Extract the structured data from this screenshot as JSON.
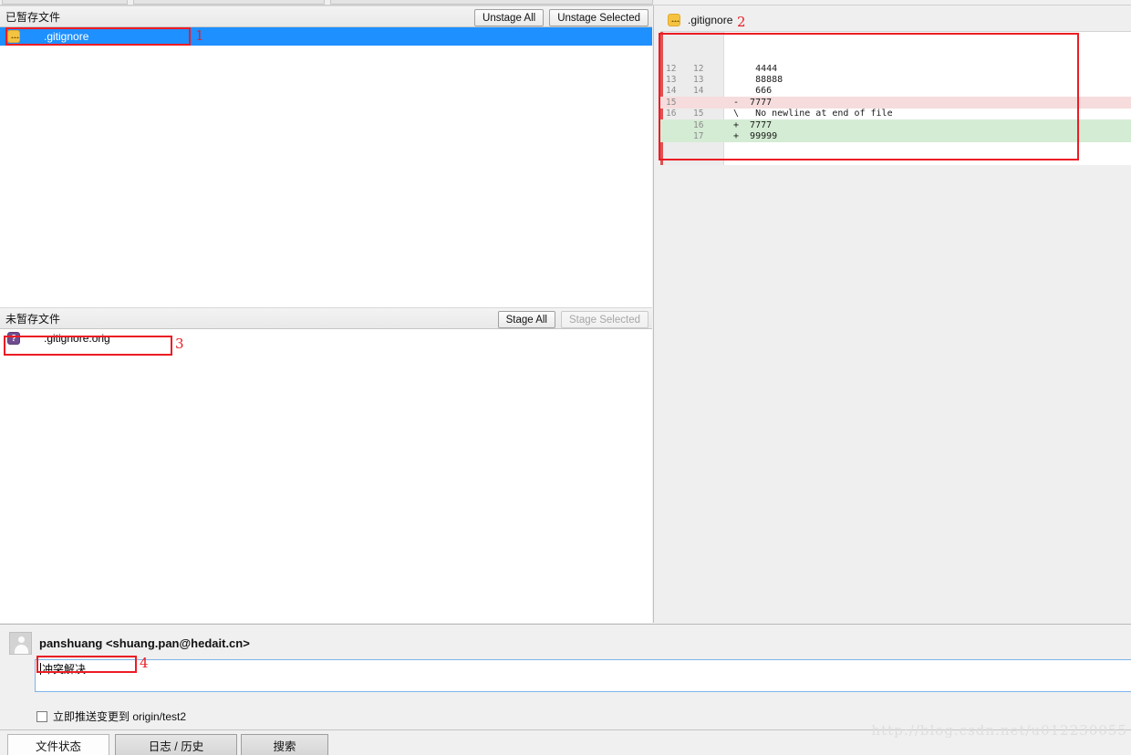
{
  "window": {
    "watermark": "http://blog.csdn.net/u012230055"
  },
  "staged_section": {
    "title": "已暂存文件",
    "unstage_all_label": "Unstage All",
    "unstage_selected_label": "Unstage Selected",
    "files": [
      {
        "name": ".gitignore",
        "status_icon": "modified-file-icon",
        "selected": true
      }
    ]
  },
  "unstaged_section": {
    "title": "未暂存文件",
    "stage_all_label": "Stage All",
    "stage_selected_label": "Stage Selected",
    "stage_selected_disabled": true,
    "files": [
      {
        "name": ".gitignore.orig",
        "status_icon": "untracked-file-icon",
        "selected": false
      }
    ]
  },
  "diff_panel": {
    "file_icon": "modified-file-icon",
    "file_name": ".gitignore",
    "rows": [
      {
        "old": "12",
        "new": "12",
        "marker": "",
        "text": "    4444",
        "type": "context"
      },
      {
        "old": "13",
        "new": "13",
        "marker": "",
        "text": "    88888",
        "type": "context"
      },
      {
        "old": "14",
        "new": "14",
        "marker": "",
        "text": "    666",
        "type": "context"
      },
      {
        "old": "15",
        "new": "",
        "marker": "-",
        "text": "-  7777",
        "type": "deleted"
      },
      {
        "old": "16",
        "new": "15",
        "marker": "\\",
        "text": "\\   No newline at end of file",
        "type": "nonewline"
      },
      {
        "old": "",
        "new": "16",
        "marker": "+",
        "text": "+  7777",
        "type": "added"
      },
      {
        "old": "",
        "new": "17",
        "marker": "+",
        "text": "+  99999",
        "type": "added"
      }
    ]
  },
  "commit": {
    "author": "panshuang <shuang.pan@hedait.cn>",
    "message": "冲突解决",
    "message_placeholder": "",
    "push_checkbox_label": "立即推送变更到 origin/test2",
    "push_checked": false
  },
  "tabs": [
    {
      "label": "文件状态",
      "active": true
    },
    {
      "label": "日志 / 历史",
      "active": false
    },
    {
      "label": "搜索",
      "active": false
    }
  ],
  "annotations": [
    {
      "number": "1"
    },
    {
      "number": "2"
    },
    {
      "number": "3"
    },
    {
      "number": "4"
    }
  ]
}
